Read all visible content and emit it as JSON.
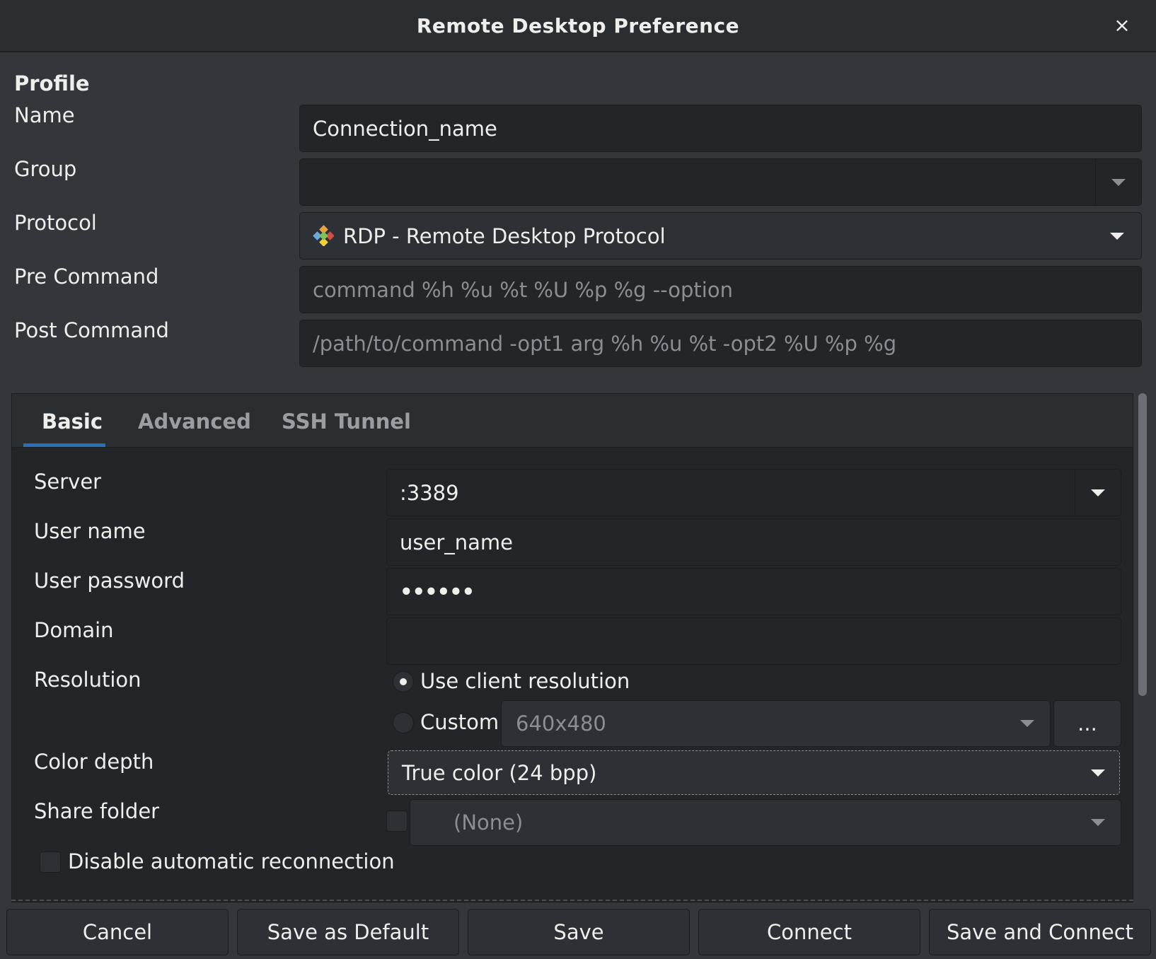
{
  "window": {
    "title": "Remote Desktop Preference",
    "close_glyph": "×"
  },
  "profile": {
    "section_title": "Profile",
    "name_label": "Name",
    "name_value": "Connection_name",
    "group_label": "Group",
    "group_value": "",
    "protocol_label": "Protocol",
    "protocol_value": "RDP - Remote Desktop Protocol",
    "protocol_icon": "rdp-protocol-icon",
    "pre_command_label": "Pre Command",
    "pre_command_placeholder": "command %h %u %t %U %p %g --option",
    "post_command_label": "Post Command",
    "post_command_placeholder": "/path/to/command -opt1 arg %h %u %t -opt2 %U %p %g"
  },
  "tabs": [
    {
      "label": "Basic",
      "active": true
    },
    {
      "label": "Advanced",
      "active": false
    },
    {
      "label": "SSH Tunnel",
      "active": false
    }
  ],
  "basic": {
    "server_label": "Server",
    "server_value": ":3389",
    "username_label": "User name",
    "username_value": "user_name",
    "password_label": "User password",
    "password_value": "••••••",
    "domain_label": "Domain",
    "domain_value": "",
    "resolution_label": "Resolution",
    "use_client_resolution_label": "Use client resolution",
    "use_client_resolution_selected": true,
    "custom_label": "Custom",
    "custom_resolution_value": "640x480",
    "resolution_more_label": "...",
    "color_depth_label": "Color depth",
    "color_depth_value": "True color (24 bpp)",
    "share_folder_label": "Share folder",
    "share_folder_value": "(None)",
    "share_folder_checked": false,
    "disable_reconnect_label": "Disable automatic reconnection",
    "disable_reconnect_checked": false
  },
  "buttons": {
    "cancel": "Cancel",
    "save_default": "Save as Default",
    "save": "Save",
    "connect": "Connect",
    "save_connect": "Save and Connect"
  },
  "colors": {
    "background": "#33373b",
    "entry_bg": "#232629",
    "accent": "#2b6fb6"
  }
}
